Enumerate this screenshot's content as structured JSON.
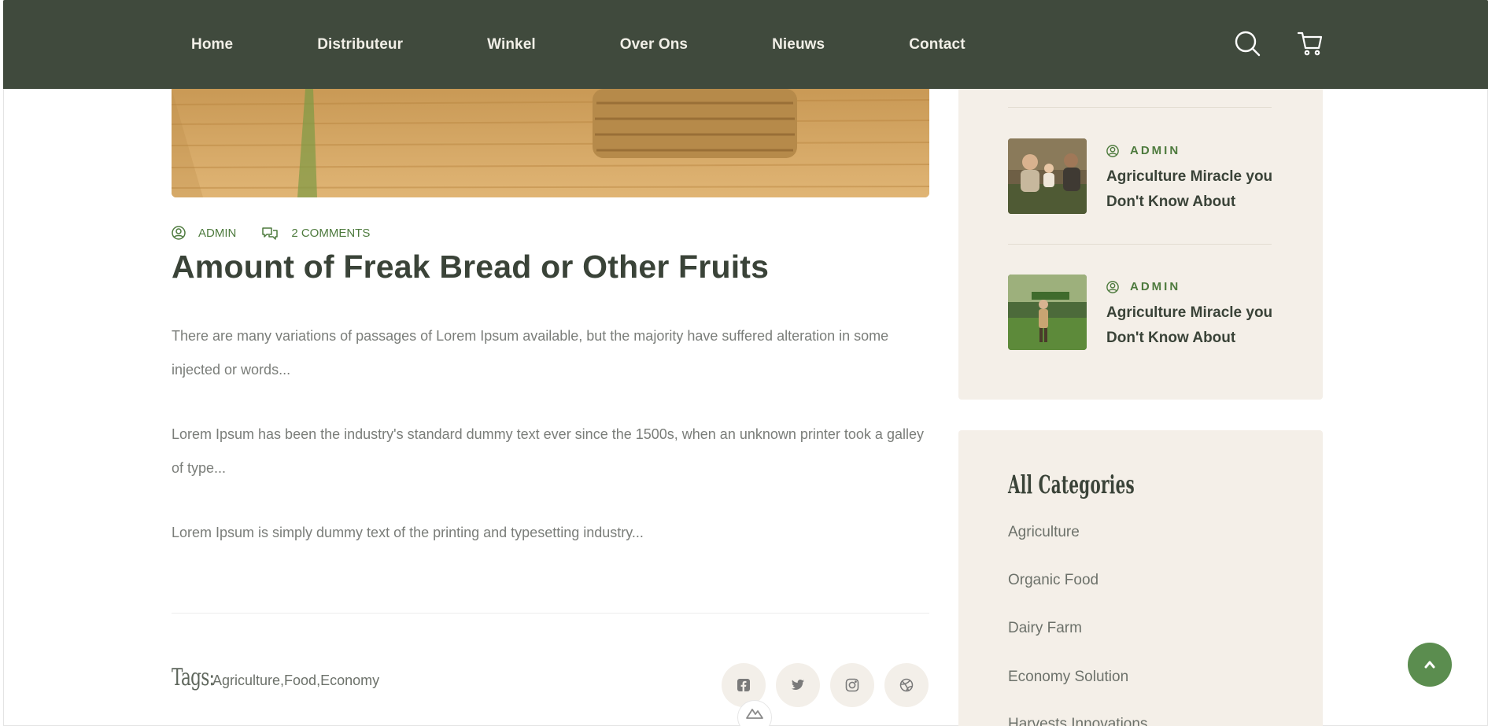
{
  "nav": {
    "items": [
      "Home",
      "Distributeur",
      "Winkel",
      "Over Ons",
      "Nieuws",
      "Contact"
    ]
  },
  "header_icons": [
    "search-icon",
    "cart-icon"
  ],
  "post": {
    "author": "ADMIN",
    "comments": "2 COMMENTS",
    "title": "Amount of Freak Bread or Other Fruits",
    "paragraphs": [
      "There are many variations of passages of Lorem Ipsum available, but the majority have suffered alteration in some injected or words...",
      "Lorem Ipsum has been the industry's standard dummy text ever since the 1500s, when an unknown printer took a galley of type...",
      "Lorem Ipsum is simply dummy text of the printing and typesetting industry..."
    ],
    "tags_label": "Tags:",
    "tags_value": "Agriculture,Food,Economy",
    "social_icons": [
      "facebook-icon",
      "twitter-icon",
      "instagram-icon",
      "dribbble-icon"
    ]
  },
  "sidebar": {
    "recent_posts": [
      {
        "author": "ADMIN",
        "title": "Agriculture Miracle you Don't Know About"
      },
      {
        "author": "ADMIN",
        "title": "Agriculture Miracle you Don't Know About"
      }
    ],
    "categories_title": "All Categories",
    "categories": [
      "Agriculture",
      "Organic Food",
      "Dairy Farm",
      "Economy Solution",
      "Harvests Innovations"
    ]
  },
  "colors": {
    "header_bg": "#404a3d",
    "accent_green": "#4d7a3d",
    "sidebar_bg": "#f4efe8",
    "scroll_top_bg": "#5b8d4f"
  }
}
